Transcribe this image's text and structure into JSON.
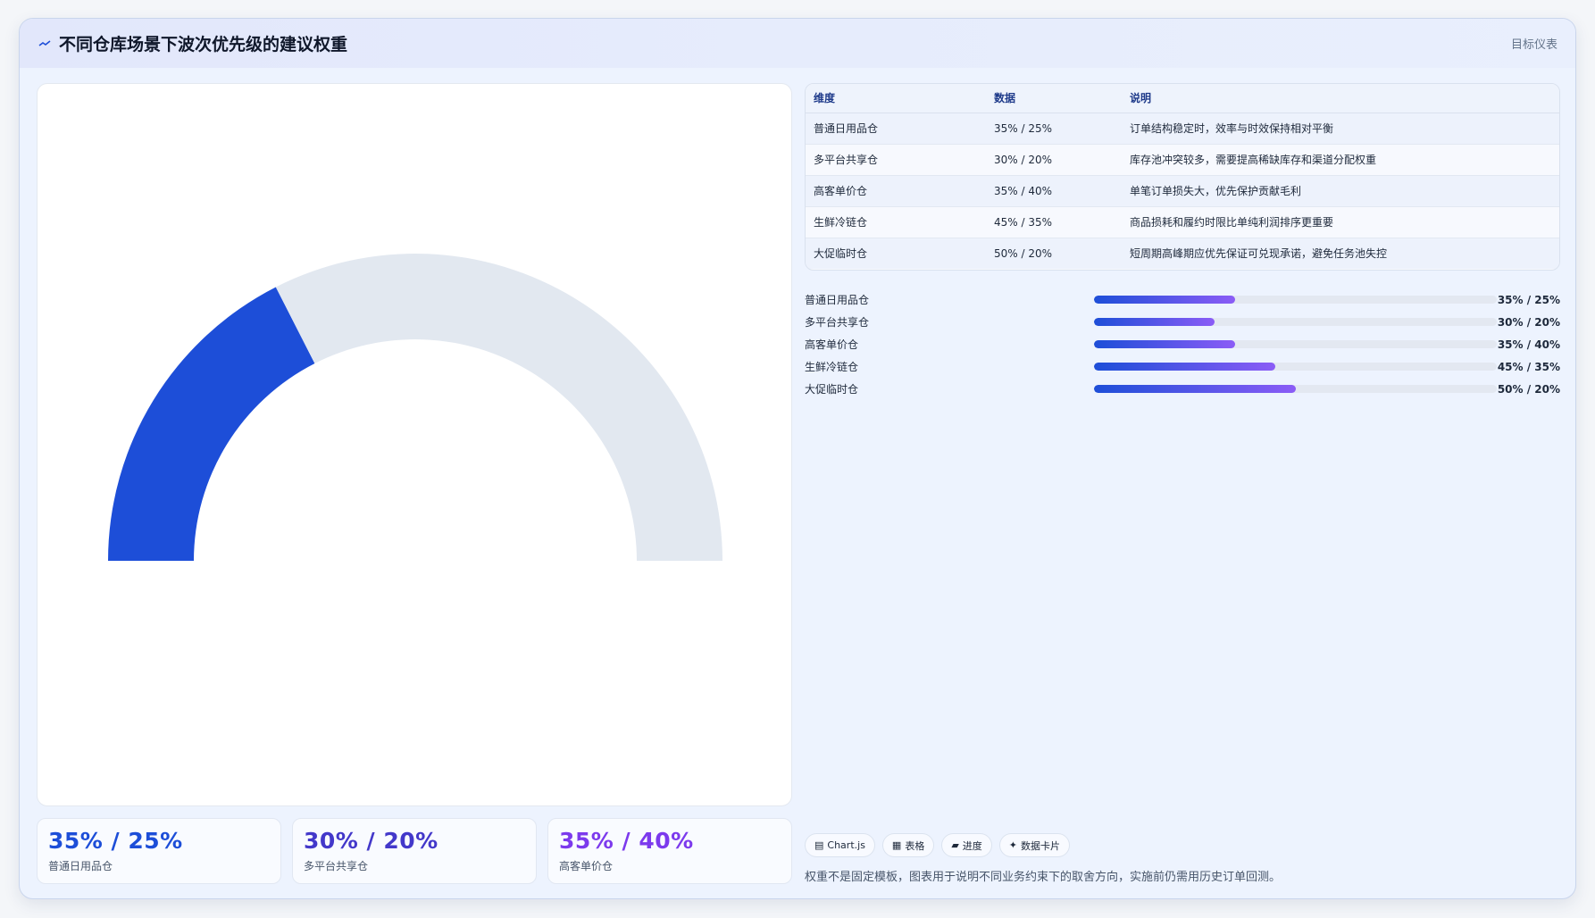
{
  "header": {
    "icon": "trend-icon",
    "title": "不同仓库场景下波次优先级的建议权重",
    "right_label": "目标仪表"
  },
  "colors": {
    "primary": "#1d4ed8",
    "accent_purple": "#8b5cf6",
    "track": "#e2e8f0"
  },
  "chart_data": {
    "type": "gauge",
    "value": 35,
    "max": 100,
    "segments": [
      {
        "value": 35,
        "color": "#1d4ed8"
      },
      {
        "value": 65,
        "color": "#e2e8f0"
      }
    ]
  },
  "kpis": [
    {
      "value": "35% / 25%",
      "label": "普通日用品仓",
      "color": "#1d4ed8"
    },
    {
      "value": "30% / 20%",
      "label": "多平台共享仓",
      "color": "#4338ca"
    },
    {
      "value": "35% / 40%",
      "label": "高客单价仓",
      "color": "#7c3aed"
    }
  ],
  "table": {
    "headers": [
      "维度",
      "数据",
      "说明"
    ],
    "rows": [
      [
        "普通日用品仓",
        "35% / 25%",
        "订单结构稳定时，效率与时效保持相对平衡"
      ],
      [
        "多平台共享仓",
        "30% / 20%",
        "库存池冲突较多，需要提高稀缺库存和渠道分配权重"
      ],
      [
        "高客单价仓",
        "35% / 40%",
        "单笔订单损失大，优先保护贡献毛利"
      ],
      [
        "生鲜冷链仓",
        "45% / 35%",
        "商品损耗和履约时限比单纯利润排序更重要"
      ],
      [
        "大促临时仓",
        "50% / 20%",
        "短周期高峰期应优先保证可兑现承诺，避免任务池失控"
      ]
    ]
  },
  "bars": [
    {
      "name": "普通日用品仓",
      "percent": 35,
      "label": "35% / 25%"
    },
    {
      "name": "多平台共享仓",
      "percent": 30,
      "label": "30% / 20%"
    },
    {
      "name": "高客单价仓",
      "percent": 35,
      "label": "35% / 40%"
    },
    {
      "name": "生鲜冷链仓",
      "percent": 45,
      "label": "45% / 35%"
    },
    {
      "name": "大促临时仓",
      "percent": 50,
      "label": "50% / 20%"
    }
  ],
  "tags": [
    {
      "icon": "chart-icon",
      "glyph": "▤",
      "label": "Chart.js"
    },
    {
      "icon": "table-icon",
      "glyph": "▦",
      "label": "表格"
    },
    {
      "icon": "progress-icon",
      "glyph": "▰",
      "label": "进度"
    },
    {
      "icon": "sparkle-icon",
      "glyph": "✦",
      "label": "数据卡片"
    }
  ],
  "note": "权重不是固定模板，图表用于说明不同业务约束下的取舍方向，实施前仍需用历史订单回测。"
}
